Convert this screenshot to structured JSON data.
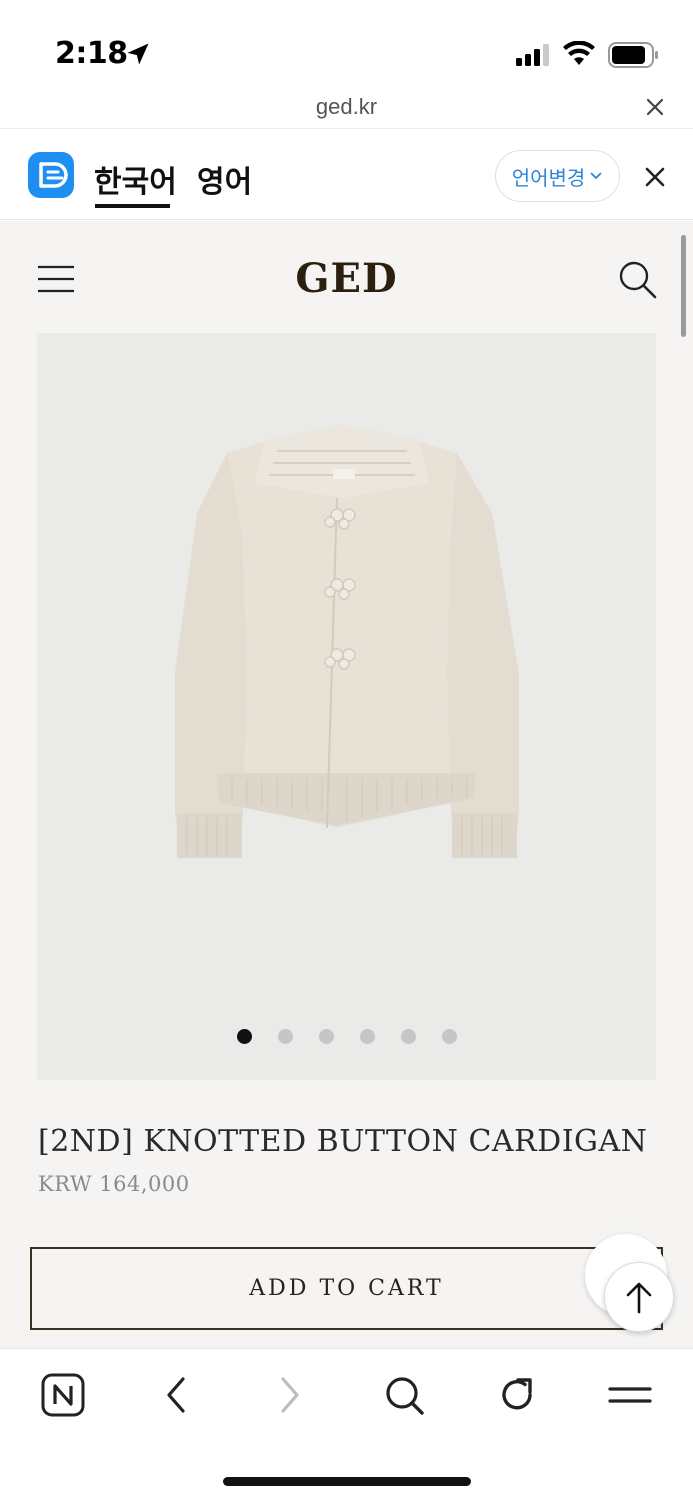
{
  "status_bar": {
    "time": "2:18"
  },
  "url_bar": {
    "url": "ged.kr"
  },
  "translate_bar": {
    "lang_korean": "한국어",
    "lang_english": "영어",
    "change_language": "언어변경"
  },
  "site": {
    "brand": "GED"
  },
  "product": {
    "title": "[2ND] KNOTTED BUTTON CARDIGAN",
    "price": "KRW 164,000",
    "add_to_cart": "ADD TO CART",
    "carousel": {
      "total_slides": 6,
      "active_index": 0
    }
  },
  "colors": {
    "page_background": "#f5f4f2",
    "brand_text": "#2b1f10",
    "translate_accent": "#2f86d8",
    "cardigan": "#e7e1d6"
  },
  "icons": [
    "location-arrow-icon",
    "signal-icon",
    "wifi-icon",
    "battery-icon",
    "close-icon",
    "translate-logo-icon",
    "hamburger-icon",
    "search-icon",
    "arrow-up-icon",
    "n-home-icon",
    "back-icon",
    "forward-icon",
    "reload-icon",
    "menu-icon"
  ]
}
